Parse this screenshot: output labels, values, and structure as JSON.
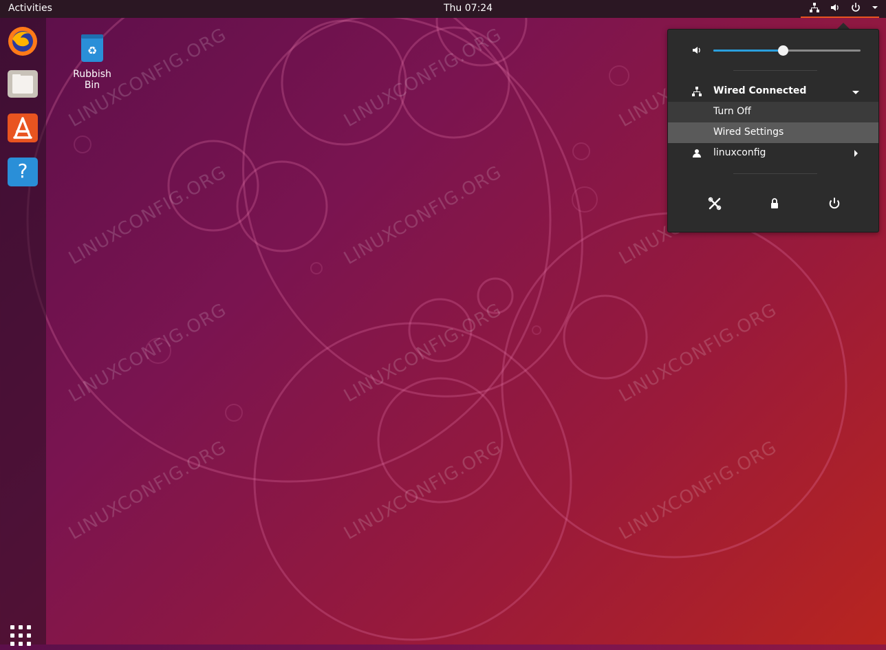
{
  "topbar": {
    "activities_label": "Activities",
    "clock": "Thu 07:24",
    "tray_icons": [
      "network-icon",
      "volume-icon",
      "power-icon",
      "chevron-down-icon"
    ]
  },
  "dock": {
    "items": [
      {
        "name": "Firefox",
        "icon": "firefox-icon"
      },
      {
        "name": "Files",
        "icon": "files-icon"
      },
      {
        "name": "Ubuntu Software",
        "icon": "software-icon"
      },
      {
        "name": "Help",
        "icon": "help-icon",
        "glyph": "?"
      }
    ],
    "show_apps_icon": "app-grid-icon"
  },
  "desktop": {
    "trash_label": "Rubbish Bin",
    "watermark": "LINUXCONFIG.ORG"
  },
  "system_menu": {
    "volume_percent": 47,
    "network_title": "Wired Connected",
    "network_items": [
      "Turn Off",
      "Wired Settings"
    ],
    "user_label": "linuxconfig",
    "bottom_icons": [
      "settings-icon",
      "lock-icon",
      "power-icon"
    ]
  },
  "colors": {
    "accent": "#e95420",
    "slider_fill": "#2aa0de",
    "menu_bg": "#2c2c2c"
  }
}
